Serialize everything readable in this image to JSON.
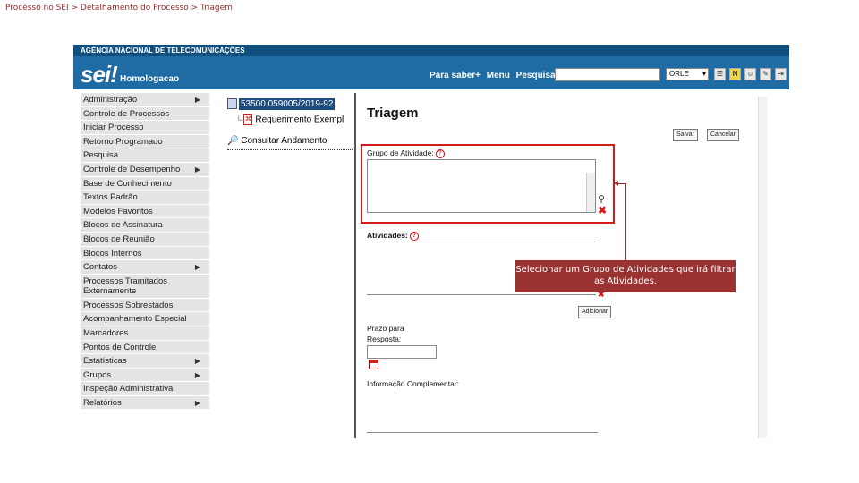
{
  "breadcrumb": "Processo no SEI > Detalhamento do Processo > Triagem",
  "header": {
    "agency": "AGÊNCIA NACIONAL DE TELECOMUNICAÇÕES",
    "logo": "sei!",
    "environment": "Homologacao",
    "links": [
      "Para saber+",
      "Menu",
      "Pesquisa"
    ],
    "search_value": "",
    "unit": "ORLE",
    "icons": [
      "list-icon",
      "notes-icon",
      "user-icon",
      "tools-icon",
      "exit-icon"
    ]
  },
  "sidebar": {
    "items": [
      {
        "label": "Administração",
        "sub": true
      },
      {
        "label": "Controle de Processos",
        "sub": false
      },
      {
        "label": "Iniciar Processo",
        "sub": false
      },
      {
        "label": "Retorno Programado",
        "sub": false
      },
      {
        "label": "Pesquisa",
        "sub": false
      },
      {
        "label": "Controle de Desempenho",
        "sub": true
      },
      {
        "label": "Base de Conhecimento",
        "sub": false
      },
      {
        "label": "Textos Padrão",
        "sub": false
      },
      {
        "label": "Modelos Favoritos",
        "sub": false
      },
      {
        "label": "Blocos de Assinatura",
        "sub": false
      },
      {
        "label": "Blocos de Reunião",
        "sub": false
      },
      {
        "label": "Blocos Internos",
        "sub": false
      },
      {
        "label": "Contatos",
        "sub": true
      },
      {
        "label": "Processos Tramitados Externamente",
        "sub": false
      },
      {
        "label": "Processos Sobrestados",
        "sub": false
      },
      {
        "label": "Acompanhamento Especial",
        "sub": false
      },
      {
        "label": "Marcadores",
        "sub": false
      },
      {
        "label": "Pontos de Controle",
        "sub": false
      },
      {
        "label": "Estatísticas",
        "sub": true
      },
      {
        "label": "Grupos",
        "sub": true
      },
      {
        "label": "Inspeção Administrativa",
        "sub": false
      },
      {
        "label": "Relatórios",
        "sub": true
      }
    ]
  },
  "tree": {
    "process_number": "53500.059005/2019-92",
    "document": "Requerimento Exempl",
    "consult": "Consultar Andamento"
  },
  "form": {
    "title": "Triagem",
    "save_button": "Salvar",
    "cancel_button": "Cancelar",
    "group_label": "Grupo de Atividade:",
    "activities_label": "Atividades:",
    "add_button": "Adicionar",
    "deadline_label_1": "Prazo para",
    "deadline_label_2": "Resposta:",
    "info_label": "Informação Complementar:"
  },
  "callout": {
    "text": "Selecionar um Grupo de Atividades que irá filtrar as Atividades."
  },
  "colors": {
    "header_blue": "#1e6ca3",
    "highlight_red": "#d21c1c",
    "callout_bg": "#9b3232"
  }
}
